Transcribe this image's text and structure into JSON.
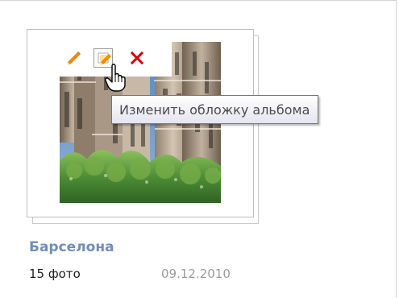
{
  "album": {
    "title": "Барселона",
    "photo_count": "15 фото",
    "date": "09.12.2010",
    "cover_description": "Sagrada Família towers with trees"
  },
  "actions": {
    "edit_icon": "pencil-icon",
    "change_cover_icon": "cover-edit-icon",
    "delete_icon": "close-icon"
  },
  "tooltip": {
    "text": "Изменить обложку альбома"
  },
  "colors": {
    "title": "#6f8eb8",
    "edit": "#f08a00",
    "delete": "#d90000",
    "tooltip_border": "#767676"
  }
}
